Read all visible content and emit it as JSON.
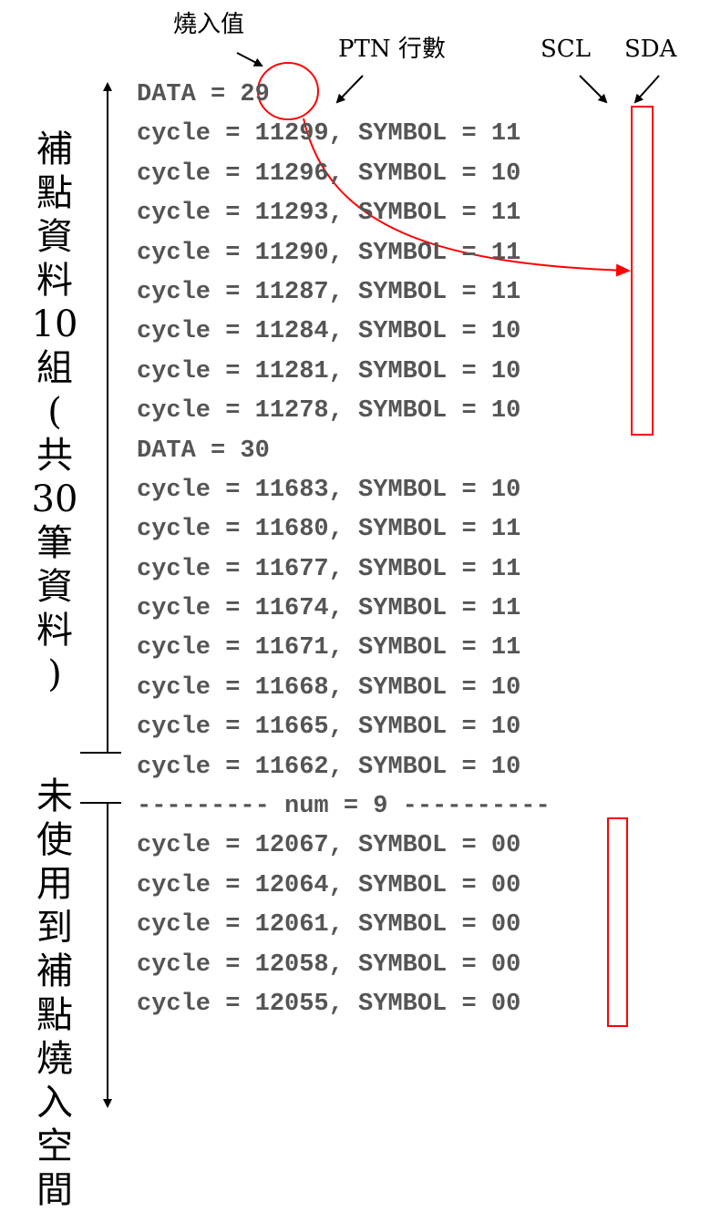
{
  "annotations": {
    "burn_value": "燒入值",
    "ptn_rows": "PTN 行數",
    "scl": "SCL",
    "sda": "SDA"
  },
  "side_labels": {
    "used": [
      "補",
      "點",
      "資",
      "料",
      "10",
      "組",
      "(",
      "共",
      "30",
      "筆",
      "資",
      "料",
      ")"
    ],
    "unused": [
      "未",
      "使",
      "用",
      "到",
      "補",
      "點",
      "燒",
      "入",
      "空",
      "間"
    ]
  },
  "code_lines": [
    "DATA = 29",
    "cycle = 11299, SYMBOL = 11",
    "cycle = 11296, SYMBOL = 10",
    "cycle = 11293, SYMBOL = 11",
    "cycle = 11290, SYMBOL = 11",
    "cycle = 11287, SYMBOL = 11",
    "cycle = 11284, SYMBOL = 10",
    "cycle = 11281, SYMBOL = 10",
    "cycle = 11278, SYMBOL = 10",
    "DATA = 30",
    "cycle = 11683, SYMBOL = 10",
    "cycle = 11680, SYMBOL = 11",
    "cycle = 11677, SYMBOL = 11",
    "cycle = 11674, SYMBOL = 11",
    "cycle = 11671, SYMBOL = 11",
    "cycle = 11668, SYMBOL = 10",
    "cycle = 11665, SYMBOL = 10",
    "cycle = 11662, SYMBOL = 10",
    "--------- num = 9 ----------",
    "cycle = 12067, SYMBOL = 00",
    "cycle = 12064, SYMBOL = 00",
    "cycle = 12061, SYMBOL = 00",
    "cycle = 12058, SYMBOL = 00",
    "cycle = 12055, SYMBOL = 00"
  ],
  "colors": {
    "code_text": "#555555",
    "highlight": "#ff0000",
    "annotation": "#000000"
  }
}
